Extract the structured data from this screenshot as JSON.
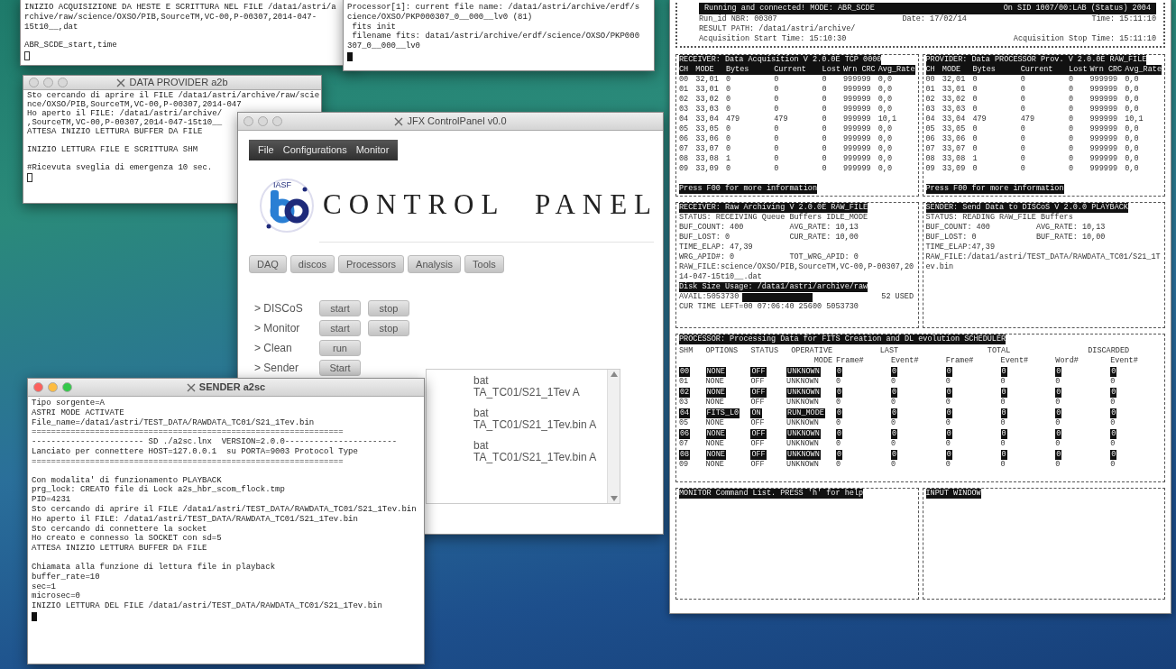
{
  "windows": [
    {
      "kind": "terminal",
      "cursor_focused": false,
      "lines": [
        {
          "text": "INIZIO ACQUISIZIONE DA HESTE E SCRITTURA NEL FILE /data1/astri/a"
        },
        {
          "text": "rchive/raw/science/OXSO/PIB,SourceTM,VC-00,P-00307,2014-047-"
        },
        {
          "text": "15t10__,dat"
        },
        {
          "text": "ABR_SCDE_start,time",
          "blank_before": true
        }
      ]
    },
    {
      "kind": "terminal",
      "cursor_focused": true,
      "lines": [
        {
          "text": "Processor[1]: current file name: /data1/astri/archive/erdf/s"
        },
        {
          "text": "cience/OXSO/PKP000307_0__000__lv0 (81)"
        },
        {
          "text": " fits init"
        },
        {
          "text": " filename fits: data1/astri/archive/erdf/science/OXSO/PKP000"
        },
        {
          "text": "307_0__000__lv0"
        }
      ]
    },
    {
      "kind": "terminal",
      "title": "DATA PROVIDER a2b",
      "active": false,
      "cursor_focused": false,
      "lines": [
        {
          "text": "Sto cercando di aprire il FILE /data1/astri/archive/raw/scie"
        },
        {
          "text": "nce/OXSO/PIB,SourceTM,VC-00,P-00307,2014-047"
        },
        {
          "text": "Ho aperto il FILE: /data1/astri/archive/"
        },
        {
          "text": ",SourceTM,VC-00,P-00307,2014-047-15t10__"
        },
        {
          "text": "ATTESA INIZIO LETTURA BUFFER DA FILE"
        },
        {
          "text": "INIZIO LETTURA FILE E SCRITTURA SHM",
          "blank_before": true
        },
        {
          "text": "#Ricevuta sveglia di emergenza 10 sec.",
          "blank_before": true
        }
      ]
    },
    {
      "kind": "control_panel",
      "title": "JFX ControlPanel v0.0",
      "active": false,
      "menu": [
        "File",
        "Configurations",
        "Monitor"
      ],
      "logo_label": "IASF",
      "heading": "CONTROL PANEL",
      "sections": [
        "DAQ",
        "discos",
        "Processors",
        "Analysis",
        "Tools"
      ],
      "actions": [
        {
          "label": "> DISCoS",
          "buttons": [
            "start",
            "stop"
          ]
        },
        {
          "label": "> Monitor",
          "buttons": [
            "start",
            "stop"
          ]
        },
        {
          "label": "> Clean",
          "buttons": [
            "run"
          ]
        },
        {
          "label": "> Sender",
          "buttons": [
            "Start"
          ]
        }
      ],
      "log_lines": [
        {
          "text": "bat"
        },
        {
          "text": "TA_TC01/S21_1Tev A"
        },
        {
          "text": "bat",
          "blank_before": true
        },
        {
          "text": "TA_TC01/S21_1Tev.bin A"
        },
        {
          "text": "bat",
          "blank_before": true
        },
        {
          "text": "TA_TC01/S21_1Tev.bin A"
        }
      ]
    },
    {
      "kind": "terminal",
      "title": "SENDER a2sc",
      "active": true,
      "cursor_focused": true,
      "lines": [
        {
          "text": "Tipo sorgente=A"
        },
        {
          "text": "ASTRI MODE ACTIVATE"
        },
        {
          "text": "File_name=/data1/astri/TEST_DATA/RAWDATA_TC01/S21_1Tev.bin"
        },
        {
          "text": "================================================================"
        },
        {
          "text": "----------------------- SD ./a2sc.lnx  VERSION=2.0.0-----------------------"
        },
        {
          "text": "Lanciato per connettere HOST=127.0.0.1  su PORTA=9003 Protocol Type"
        },
        {
          "text": "================================================================"
        },
        {
          "text": "Con modalita' di funzionamento PLAYBACK",
          "blank_before": true
        },
        {
          "text": "prg_lock: CREATO file di Lock a2s_hbr_scom_flock.tmp"
        },
        {
          "text": "PID=4231"
        },
        {
          "text": "Sto cercando di aprire il FILE /data1/astri/TEST_DATA/RAWDATA_TC01/S21_1Tev.bin"
        },
        {
          "text": "Ho aperto il FILE: /data1/astri/TEST_DATA/RAWDATA_TC01/S21_1Tev.bin"
        },
        {
          "text": "Sto cercando di connettere la socket"
        },
        {
          "text": "Ho creato e connesso la SOCKET con sd=5"
        },
        {
          "text": "ATTESA INIZIO LETTURA BUFFER DA FILE"
        },
        {
          "text": "Chiamata alla funzione di lettura file in playback",
          "blank_before": true
        },
        {
          "text": "buffer_rate=10"
        },
        {
          "text": "sec=1"
        },
        {
          "text": "microsec=0"
        },
        {
          "text": "INIZIO LETTURA DEL FILE /data1/astri/TEST_DATA/RAWDATA_TC01/S21_1Tev.bin"
        }
      ]
    },
    {
      "kind": "monitor",
      "header_bar": [
        "Running and connected!  MODE: ABR_SCDE",
        "On SID 1007/00:LAB (Status) 2004"
      ],
      "info_rows": [
        [
          "Run_id NBR: 00307",
          "Date: 17/02/14",
          "Time: 15:11:10"
        ],
        [
          "RESULT PATH: /data1/astri/archive/"
        ],
        [
          "Acquisition Start Time:  15:10:30",
          "Acquisition Stop Time:  15:11:10"
        ]
      ],
      "panels": [
        {
          "kind": "channels",
          "title": "RECEIVER: Data Acquisition V 2.0.0E TCP 0000",
          "columns": [
            "CH",
            "MODE",
            "Bytes",
            "Current",
            "Lost",
            "Wrn CRC",
            "Avg_Rate"
          ],
          "rows": [
            [
              "00",
              "32,01",
              "0",
              "0",
              "0",
              "999999",
              "0,0"
            ],
            [
              "01",
              "33,01",
              "0",
              "0",
              "0",
              "999999",
              "0,0"
            ],
            [
              "02",
              "33,02",
              "0",
              "0",
              "0",
              "999999",
              "0,0"
            ],
            [
              "03",
              "33,03",
              "0",
              "0",
              "0",
              "999999",
              "0,0"
            ],
            [
              "04",
              "33,04",
              "479",
              "479",
              "0",
              "999999",
              "10,1"
            ],
            [
              "05",
              "33,05",
              "0",
              "0",
              "0",
              "999999",
              "0,0"
            ],
            [
              "06",
              "33,06",
              "0",
              "0",
              "0",
              "999999",
              "0,0"
            ],
            [
              "07",
              "33,07",
              "0",
              "0",
              "0",
              "999999",
              "0,0"
            ],
            [
              "08",
              "33,08",
              "1",
              "0",
              "0",
              "999999",
              "0,0"
            ],
            [
              "09",
              "33,09",
              "0",
              "0",
              "0",
              "999999",
              "0,0"
            ]
          ],
          "footer": "Press F00 for more information"
        },
        {
          "kind": "channels",
          "title": "PROVIDER: Data PROCESSOR Prov. V 2.0.0E RAW_FILE",
          "columns": [
            "CH",
            "MODE",
            "Bytes",
            "Current",
            "Lost",
            "Wrn CRC",
            "Avg_Rate"
          ],
          "rows": [
            [
              "00",
              "32,01",
              "0",
              "0",
              "0",
              "999999",
              "0,0"
            ],
            [
              "01",
              "33,01",
              "0",
              "0",
              "0",
              "999999",
              "0,0"
            ],
            [
              "02",
              "33,02",
              "0",
              "0",
              "0",
              "999999",
              "0,0"
            ],
            [
              "03",
              "33,03",
              "0",
              "0",
              "0",
              "999999",
              "0,0"
            ],
            [
              "04",
              "33,04",
              "479",
              "479",
              "0",
              "999999",
              "10,1"
            ],
            [
              "05",
              "33,05",
              "0",
              "0",
              "0",
              "999999",
              "0,0"
            ],
            [
              "06",
              "33,06",
              "0",
              "0",
              "0",
              "999999",
              "0,0"
            ],
            [
              "07",
              "33,07",
              "0",
              "0",
              "0",
              "999999",
              "0,0"
            ],
            [
              "08",
              "33,08",
              "1",
              "0",
              "0",
              "999999",
              "0,0"
            ],
            [
              "09",
              "33,09",
              "0",
              "0",
              "0",
              "999999",
              "0,0"
            ]
          ],
          "footer": "Press F00 for more information"
        },
        {
          "kind": "status",
          "title": "RECEIVER: Raw Archiving V 2.0.0E RAW_FILE",
          "lines": [
            [
              "STATUS:   RECEIVING Queue Buffers IDLE_MODE"
            ],
            [
              "BUF_COUNT: 400",
              "AVG_RATE:  10,13"
            ],
            [
              "BUF_LOST:  0",
              "CUR_RATE:  10,00"
            ],
            [
              "TIME_ELAP: 47,39"
            ],
            [
              "WRG_APID#: 0",
              "TOT_WRG_APID: 0"
            ],
            [
              "RAW_FILE:science/OXSO/PIB,SourceTM,VC-00,P-00307,2014-047-15t10__.dat"
            ]
          ],
          "disk": {
            "title": "Disk Size Usage: /data1/astri/archive/raw",
            "avail": "AVAIL:5053730",
            "level": 0.52,
            "used": "52 USED",
            "time_left": "CUR TIME LEFT=00 07:06:40 25600 5053730"
          }
        },
        {
          "kind": "status",
          "title": "SENDER: Send Data to DISCoS V 2.0.0 PLAYBACK",
          "lines": [
            [
              "STATUS:   READING RAW_FILE Buffers"
            ],
            [
              "BUF_COUNT: 400",
              "AVG_RATE:  10,13"
            ],
            [
              "BUF_LOST:  0",
              "BUF_RATE:  10,00"
            ],
            [
              "TIME_ELAP:47,39"
            ],
            [
              "RAW_FILE:/data1/astri/TEST_DATA/RAWDATA_TC01/S21_1Tev.bin"
            ]
          ]
        },
        {
          "kind": "processor",
          "title": "PROCESSOR: Processing Data for FITS Creation and DL evolution  SCHEDULER",
          "column_groups": [
            {
              "label": "SHM"
            },
            {
              "label": "OPTIONS"
            },
            {
              "label": "STATUS"
            },
            {
              "label": "OPERATIVE MODE"
            },
            {
              "label": "LAST",
              "columns": [
                "Frame#",
                "Event#"
              ]
            },
            {
              "label": "TOTAL",
              "columns": [
                "Frame#",
                "Event#"
              ]
            },
            {
              "label": "DISCARDED",
              "columns": [
                "Word#",
                "Event#"
              ]
            }
          ],
          "rows": [
            {
              "highlighted": true,
              "cells": [
                "00",
                "NONE",
                "OFF",
                "UNKNOWN",
                "0",
                "0",
                "0",
                "0",
                "0",
                "0"
              ]
            },
            {
              "highlighted": false,
              "cells": [
                "01",
                "NONE",
                "OFF",
                "UNKNOWN",
                "0",
                "0",
                "0",
                "0",
                "0",
                "0"
              ]
            },
            {
              "highlighted": true,
              "cells": [
                "02",
                "NONE",
                "OFF",
                "UNKNOWN",
                "0",
                "0",
                "0",
                "0",
                "0",
                "0"
              ]
            },
            {
              "highlighted": false,
              "cells": [
                "03",
                "NONE",
                "OFF",
                "UNKNOWN",
                "0",
                "0",
                "0",
                "0",
                "0",
                "0"
              ]
            },
            {
              "highlighted": true,
              "cells": [
                "04",
                "FITS_L0",
                "ON",
                "RUN_MODE",
                "0",
                "0",
                "0",
                "0",
                "0",
                "0"
              ]
            },
            {
              "highlighted": false,
              "cells": [
                "05",
                "NONE",
                "OFF",
                "UNKNOWN",
                "0",
                "0",
                "0",
                "0",
                "0",
                "0"
              ]
            },
            {
              "highlighted": true,
              "cells": [
                "06",
                "NONE",
                "OFF",
                "UNKNOWN",
                "0",
                "0",
                "0",
                "0",
                "0",
                "0"
              ]
            },
            {
              "highlighted": false,
              "cells": [
                "07",
                "NONE",
                "OFF",
                "UNKNOWN",
                "0",
                "0",
                "0",
                "0",
                "0",
                "0"
              ]
            },
            {
              "highlighted": true,
              "cells": [
                "08",
                "NONE",
                "OFF",
                "UNKNOWN",
                "0",
                "0",
                "0",
                "0",
                "0",
                "0"
              ]
            },
            {
              "highlighted": false,
              "cells": [
                "09",
                "NONE",
                "OFF",
                "UNKNOWN",
                "0",
                "0",
                "0",
                "0",
                "0",
                "0"
              ]
            }
          ]
        },
        {
          "kind": "empty",
          "title": "MONITOR Command List. PRESS 'h' for help"
        },
        {
          "kind": "empty",
          "title": "INPUT WINDOW"
        }
      ]
    }
  ]
}
